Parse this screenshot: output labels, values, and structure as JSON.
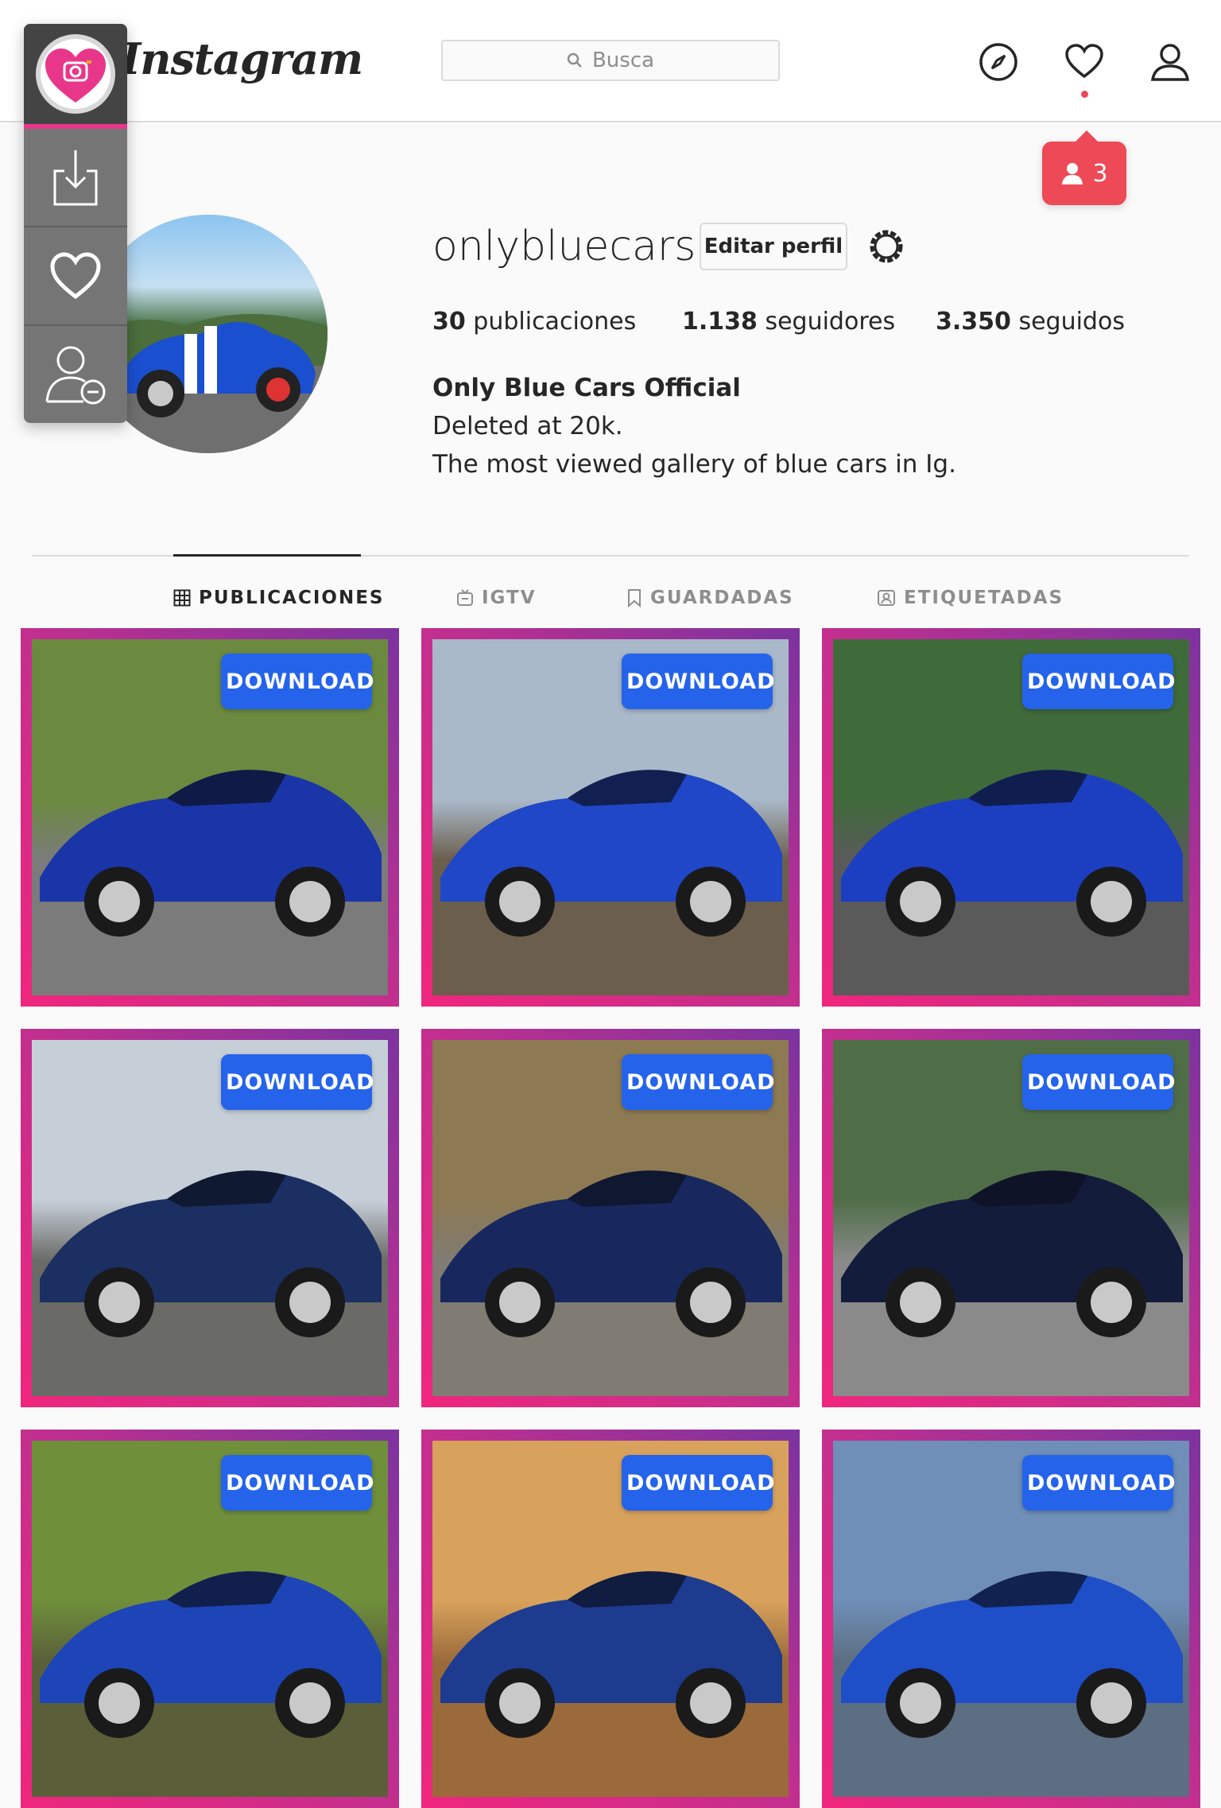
{
  "header": {
    "logo_text": "Instagram",
    "search_placeholder": "Busca",
    "notification_count": "3"
  },
  "extension": {
    "buttons": [
      "download-icon",
      "heart-icon",
      "remove-user-icon"
    ]
  },
  "profile": {
    "username": "onlybluecars",
    "edit_button": "Editar perfil",
    "stats": {
      "posts_count": "30",
      "posts_label": "publicaciones",
      "followers_count": "1.138",
      "followers_label": "seguidores",
      "following_count": "3.350",
      "following_label": "seguidos"
    },
    "bio": {
      "name": "Only Blue Cars Official",
      "line1": "Deleted at 20k.",
      "line2": "The most viewed gallery of blue cars in Ig."
    }
  },
  "tabs": [
    {
      "label": "PUBLICACIONES",
      "active": true
    },
    {
      "label": "IGTV"
    },
    {
      "label": "GUARDADAS"
    },
    {
      "label": "ETIQUETADAS"
    }
  ],
  "posts": {
    "download_label": "DOWNLOAD",
    "items": [
      {
        "sky": "#6b8a3f",
        "ground": "#7b7b7b",
        "car": "#1a35a8"
      },
      {
        "sky": "#a9b9c9",
        "ground": "#6b5e4d",
        "car": "#1f47c7"
      },
      {
        "sky": "#3f6a3a",
        "ground": "#5a5a5a",
        "car": "#1c3fc1"
      },
      {
        "sky": "#c6cfd8",
        "ground": "#6a6a66",
        "car": "#1b2f63"
      },
      {
        "sky": "#8d7a52",
        "ground": "#807b73",
        "car": "#18285e"
      },
      {
        "sky": "#4f6e48",
        "ground": "#8a8a8a",
        "car": "#141c3c"
      },
      {
        "sky": "#6f8f3b",
        "ground": "#5a5f3a",
        "car": "#1d45b8"
      },
      {
        "sky": "#d8a25c",
        "ground": "#9a6a3a",
        "car": "#1d3b8f"
      },
      {
        "sky": "#6f8fb8",
        "ground": "#5c6e82",
        "car": "#1f4ec9"
      }
    ]
  },
  "colors": {
    "accent_red": "#ed4956",
    "download_blue": "#2563eb",
    "border_pink": "#f0267d",
    "border_purple": "#7c33a0"
  }
}
